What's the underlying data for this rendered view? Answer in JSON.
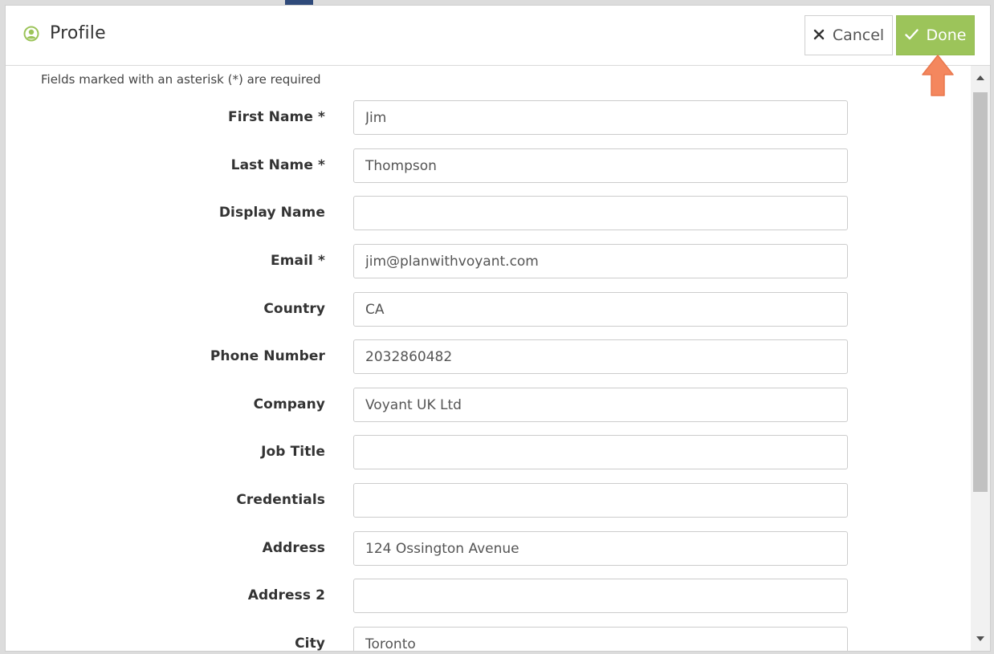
{
  "dialog": {
    "title": "Profile",
    "title_icon": "user-circle-icon",
    "accent_color": "#9cc45a",
    "cancel_label": "Cancel",
    "cancel_icon": "close-icon",
    "done_label": "Done",
    "done_icon": "checkmark-icon",
    "pointer_color": "#f4875e"
  },
  "form": {
    "hint": "Fields marked with an asterisk (*) are required",
    "fields": [
      {
        "label": "First Name *",
        "value": "Jim"
      },
      {
        "label": "Last Name *",
        "value": "Thompson"
      },
      {
        "label": "Display Name",
        "value": ""
      },
      {
        "label": "Email *",
        "value": "jim@planwithvoyant.com"
      },
      {
        "label": "Country",
        "value": "CA"
      },
      {
        "label": "Phone Number",
        "value": "2032860482"
      },
      {
        "label": "Company",
        "value": "Voyant UK Ltd"
      },
      {
        "label": "Job Title",
        "value": ""
      },
      {
        "label": "Credentials",
        "value": ""
      },
      {
        "label": "Address",
        "value": "124 Ossington Avenue"
      },
      {
        "label": "Address 2",
        "value": ""
      },
      {
        "label": "City",
        "value": "Toronto"
      }
    ]
  }
}
